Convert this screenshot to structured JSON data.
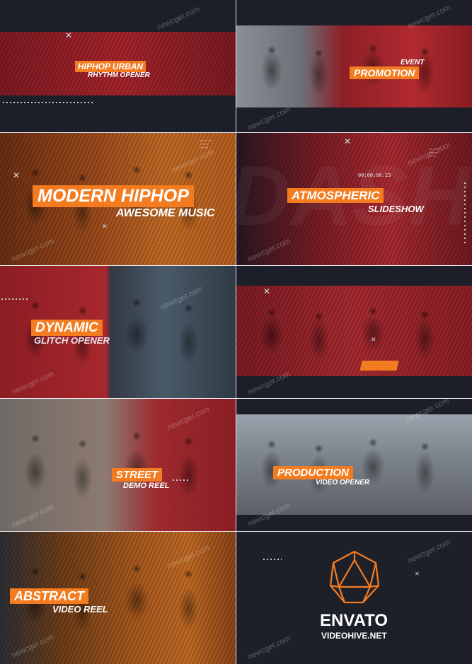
{
  "colors": {
    "accent": "#f47c20",
    "background": "#1c1f29",
    "red": "#b8262c",
    "separator": "#e9e9ee"
  },
  "watermark": "newcger.com",
  "tiles": [
    {
      "title": "HIPHOP URBAN",
      "subtitle": "RHYTHM OPENER"
    },
    {
      "title": "PROMOTION",
      "kicker": "EVENT"
    },
    {
      "title": "MODERN HIPHOP",
      "subtitle": "AWESOME MUSIC"
    },
    {
      "title": "ATMOSPHERIC",
      "subtitle": "SLIDESHOW",
      "timecode": "00:00:00:23"
    },
    {
      "title": "DYNAMIC",
      "subtitle": "GLITCH OPENER"
    },
    {
      "title": ""
    },
    {
      "title": "STREET",
      "subtitle": "DEMO REEL"
    },
    {
      "title": "PRODUCTION",
      "subtitle": "VIDEO OPENER"
    },
    {
      "title": "ABSTRACT",
      "subtitle": "VIDEO REEL"
    },
    {
      "title": "ENVATO",
      "subtitle": "VIDEOHIVE.NET",
      "logo": "envato-polyhedron-icon"
    }
  ]
}
